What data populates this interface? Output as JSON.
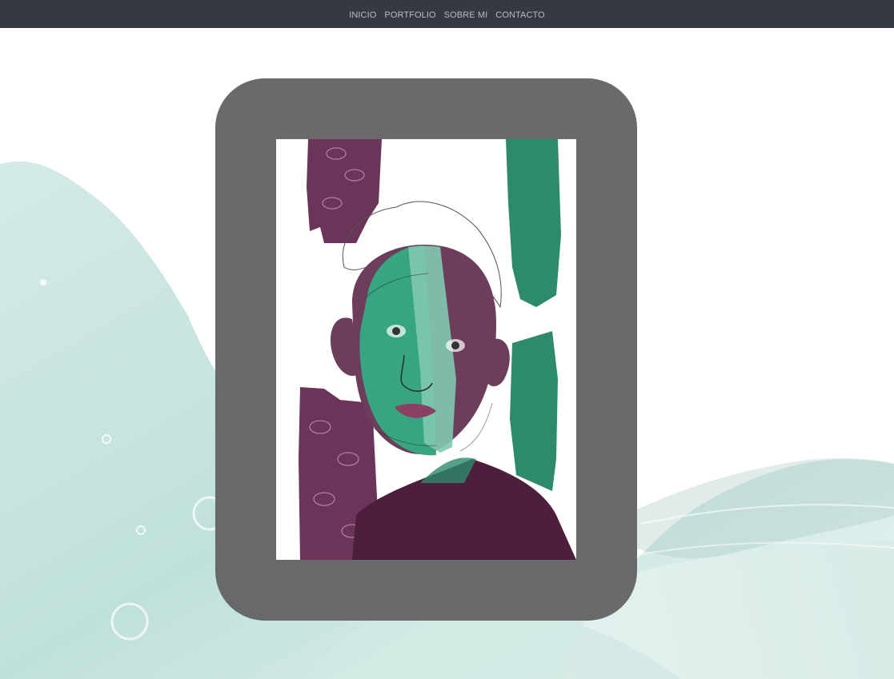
{
  "nav": {
    "items": [
      {
        "label": "INICIO"
      },
      {
        "label": "PORTFOLIO"
      },
      {
        "label": "SOBRE MI"
      },
      {
        "label": "CONTACTO"
      }
    ]
  },
  "colors": {
    "navbar": "#343a40",
    "nav_text": "#b8bcc0",
    "frame": "#646466",
    "teal": "#2e8a6c",
    "plum": "#6a3558",
    "wash": "#c9e6e2"
  },
  "artwork": {
    "icon": "portrait-illustration"
  }
}
